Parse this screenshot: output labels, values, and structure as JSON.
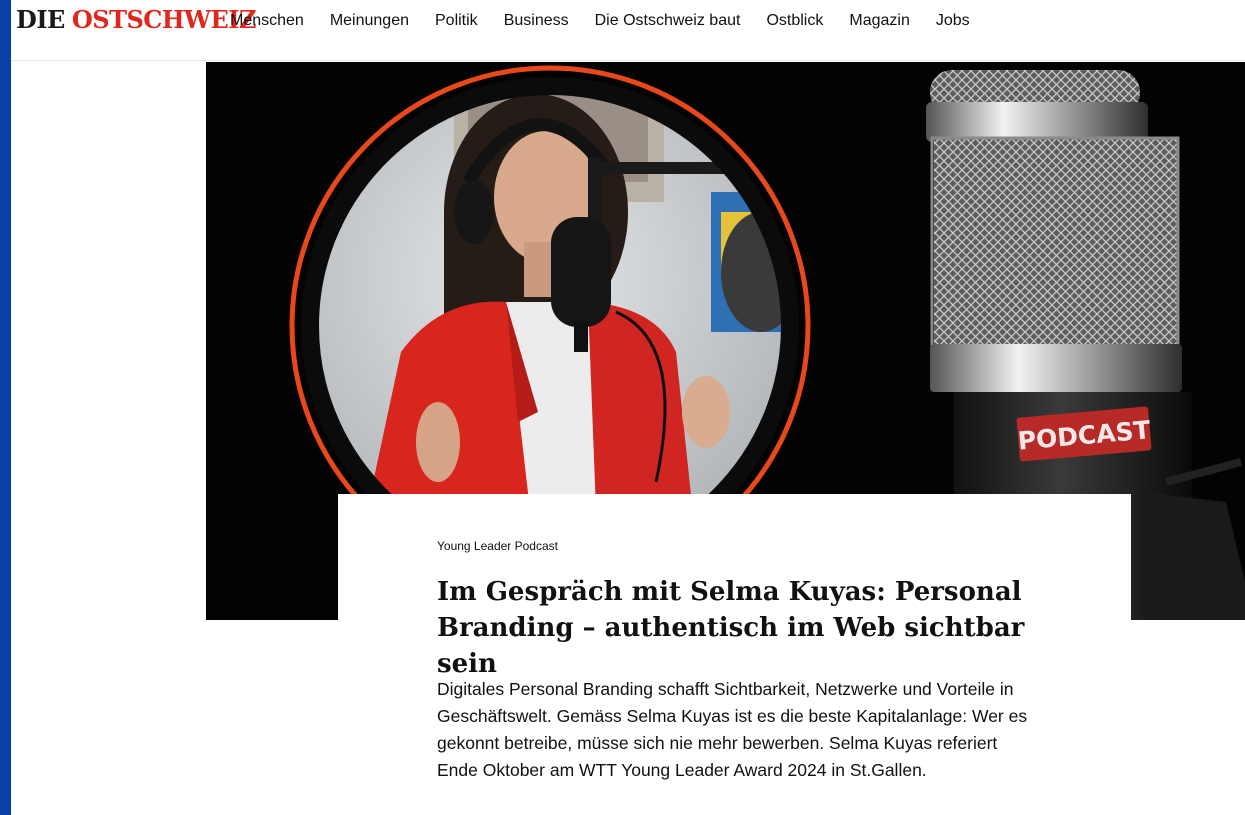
{
  "header": {
    "logo_die": "DIE",
    "logo_ostschweiz": "OSTSCHWEIZ",
    "nav": [
      "Menschen",
      "Meinungen",
      "Politik",
      "Business",
      "Die Ostschweiz baut",
      "Ostblick",
      "Magazin",
      "Jobs"
    ]
  },
  "hero": {
    "mic_badge": "PODCAST"
  },
  "article": {
    "kicker": "Young Leader Podcast",
    "title": "Im Gespräch mit Selma Kuyas: Personal Branding – authentisch im Web sichtbar sein",
    "lead": "Digitales Personal Branding schafft Sichtbarkeit, Netzwerke und Vorteile in Geschäftswelt. Gemäss Selma Kuyas ist es die beste Kapitalanlage: Wer es gekonnt betreibe, müsse sich nie mehr bewerben. Selma Kuyas referiert Ende Oktober am WTT Young Leader Award 2024 in St.Gallen."
  },
  "colors": {
    "brand_red": "#e1261c",
    "left_strip": "#0b3fa8",
    "ring_orange": "#e8481c",
    "blazer_red": "#d8261f"
  }
}
